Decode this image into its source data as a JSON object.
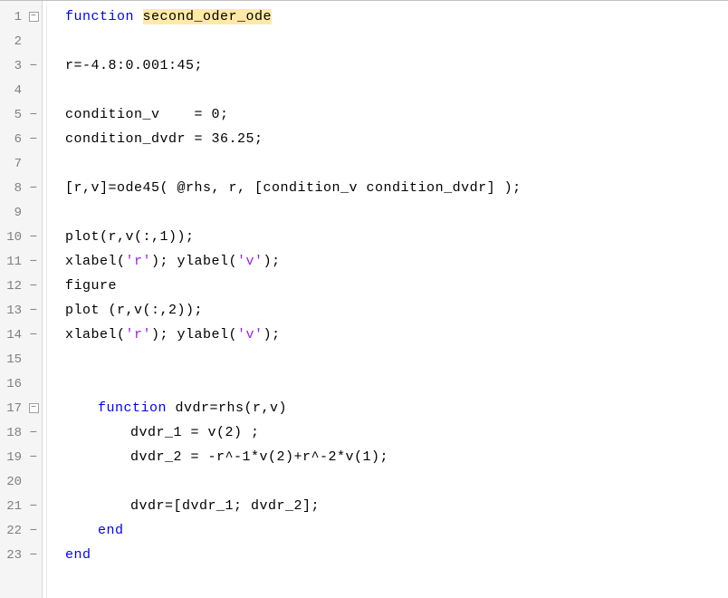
{
  "lines": [
    {
      "n": 1,
      "fold": "box-minus"
    },
    {
      "n": 2,
      "fold": ""
    },
    {
      "n": 3,
      "fold": "dash"
    },
    {
      "n": 4,
      "fold": ""
    },
    {
      "n": 5,
      "fold": "dash"
    },
    {
      "n": 6,
      "fold": "dash"
    },
    {
      "n": 7,
      "fold": ""
    },
    {
      "n": 8,
      "fold": "dash"
    },
    {
      "n": 9,
      "fold": ""
    },
    {
      "n": 10,
      "fold": "dash"
    },
    {
      "n": 11,
      "fold": "dash"
    },
    {
      "n": 12,
      "fold": "dash"
    },
    {
      "n": 13,
      "fold": "dash"
    },
    {
      "n": 14,
      "fold": "dash"
    },
    {
      "n": 15,
      "fold": ""
    },
    {
      "n": 16,
      "fold": ""
    },
    {
      "n": 17,
      "fold": "box-minus"
    },
    {
      "n": 18,
      "fold": "dash"
    },
    {
      "n": 19,
      "fold": "dash"
    },
    {
      "n": 20,
      "fold": ""
    },
    {
      "n": 21,
      "fold": "dash"
    },
    {
      "n": 22,
      "fold": "dash"
    },
    {
      "n": 23,
      "fold": "dash"
    }
  ],
  "code": {
    "l1_kw": "function",
    "l1_sp": " ",
    "l1_name": "second_oder_ode",
    "l3": "r=-4.8:0.001:45;",
    "l5": "condition_v    = 0;",
    "l6": "condition_dvdr = 36.25;",
    "l8": "[r,v]=ode45( @rhs, r, [condition_v condition_dvdr] );",
    "l10": "plot(r,v(:,1));",
    "l11a": "xlabel(",
    "l11s1": "'r'",
    "l11b": "); ylabel(",
    "l11s2": "'v'",
    "l11c": ");",
    "l12": "figure",
    "l13": "plot (r,v(:,2));",
    "l14a": "xlabel(",
    "l14s1": "'r'",
    "l14s2": "'v'",
    "l14b": "); ylabel(",
    "l14c": ");",
    "l17_kw": "function",
    "l17_rest": " dvdr=rhs(r,v)",
    "l18": "dvdr_1 = v(2) ;",
    "l19": "dvdr_2 = -r^-1*v(2)+r^-2*v(1);",
    "l21": "dvdr=[dvdr_1; dvdr_2];",
    "l22": "end",
    "l23": "end"
  }
}
